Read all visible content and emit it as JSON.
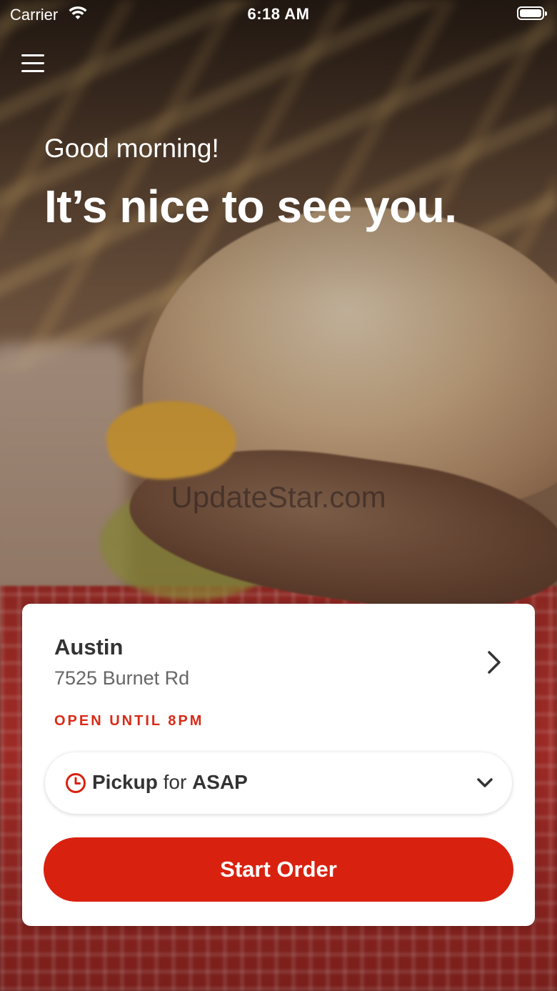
{
  "status_bar": {
    "carrier": "Carrier",
    "time": "6:18 AM",
    "icons": [
      "wifi-icon",
      "battery-icon"
    ]
  },
  "header": {
    "menu_icon": "hamburger-menu-icon"
  },
  "hero": {
    "greeting": "Good morning!",
    "headline": "It’s nice to see you."
  },
  "watermark": "UpdateStar.com",
  "location_card": {
    "city": "Austin",
    "address": "7525 Burnet Rd",
    "hours": "OPEN UNTIL 8PM",
    "order_type": {
      "mode": "Pickup",
      "connector": "for",
      "time": "ASAP",
      "icon": "clock-icon"
    },
    "start_button": "Start Order"
  },
  "colors": {
    "accent": "#d9210f",
    "hours_text": "#d82a17",
    "card_bg": "#ffffff"
  }
}
